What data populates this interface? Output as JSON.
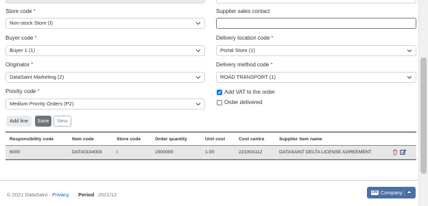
{
  "form": {
    "store_code": {
      "label": "Store code",
      "value": "Non-stock Store (I)"
    },
    "supplier_sales_contact": {
      "label": "Supplier sales contact",
      "value": ""
    },
    "buyer_code": {
      "label": "Buyer code",
      "value": "Buyer 1 (1)"
    },
    "delivery_location_code": {
      "label": "Delivery location code",
      "value": "Portal Store (1)"
    },
    "originator": {
      "label": "Originator",
      "value": "DataSaint Marketing (2)"
    },
    "delivery_method_code": {
      "label": "Delivery method code",
      "value": "ROAD TRANSPORT (1)"
    },
    "priority_code": {
      "label": "Priority code",
      "value": "Medium Priority Orders (P2)"
    },
    "add_vat": {
      "label": "Add VAT to the order",
      "checked": true
    },
    "order_delivered": {
      "label": "Order delivered",
      "checked": false
    },
    "required_mark": "*"
  },
  "buttons": {
    "add_line": "Add line",
    "save": "Save",
    "new": "New"
  },
  "table": {
    "headers": [
      "Responsibility code",
      "Item code",
      "Store code",
      "Order quantity",
      "Unit cost",
      "Cost centre",
      "Supplier item name"
    ],
    "rows": [
      [
        "6000",
        "DATA0104003",
        "I",
        "1500000",
        "1.00",
        "22100A112",
        "DATASAINT DELTA LICENSE AGREEMENT"
      ]
    ]
  },
  "footer": {
    "copyright": "© 2021 DataSaint - ",
    "privacy": "Privacy",
    "period_label": "Period",
    "period_value": "2021/12",
    "company_badge": "DM",
    "company_label": "Company"
  },
  "icons": {
    "delete": "trash-icon",
    "edit": "edit-icon",
    "chevron": "chevron-down-icon",
    "caret": "caret-up-icon"
  },
  "colors": {
    "required": "#dc3545",
    "save_button": "#6c757d",
    "company_button": "#4a6fa5",
    "delete_icon": "#e05a5a",
    "edit_icon": "#1a3d7c"
  }
}
